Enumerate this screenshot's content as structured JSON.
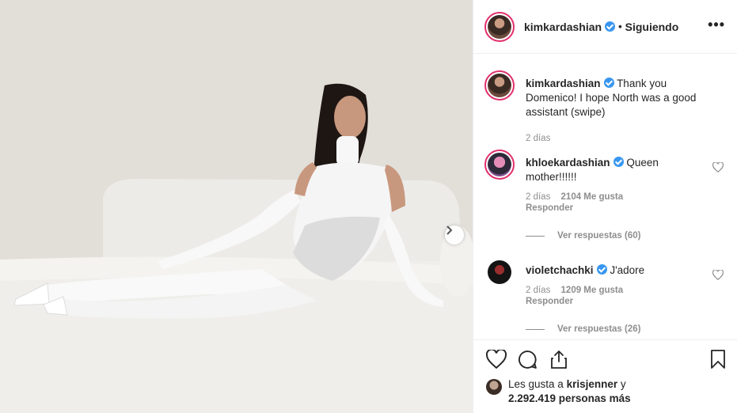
{
  "post": {
    "author": "kimkardashian",
    "follow_status": "Siguiendo",
    "separator": "•",
    "more_label": "•••"
  },
  "caption": {
    "username": "kimkardashian",
    "text": "Thank you Domenico! I hope North was a good assistant (swipe)",
    "time": "2 días"
  },
  "comments": [
    {
      "username": "khloekardashian",
      "text": "Queen mother!!!!!!",
      "time": "2 días",
      "likes": "2104 Me gusta",
      "reply_label": "Responder",
      "view_replies": "Ver respuestas (60)"
    },
    {
      "username": "violetchachki",
      "text": "J'adore",
      "time": "2 días",
      "likes": "1209 Me gusta",
      "reply_label": "Responder",
      "view_replies": "Ver respuestas (26)"
    }
  ],
  "likes_summary": {
    "prefix": "Les gusta a",
    "user": "krisjenner",
    "connector": "y",
    "count": "2.292.419 personas más"
  },
  "icons": {
    "like": "heart-icon",
    "comment": "comment-icon",
    "share": "share-icon",
    "save": "bookmark-icon",
    "next": "chevron-right-icon",
    "verified": "verified-badge-icon"
  },
  "colors": {
    "verified": "#3897f0",
    "story_ring": "#e1306c",
    "muted_text": "#8e8e8e",
    "text": "#262626"
  }
}
